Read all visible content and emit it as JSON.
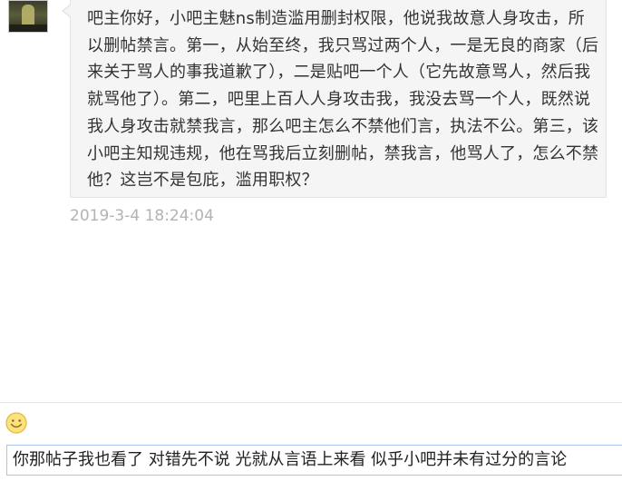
{
  "message": {
    "text": "吧主你好，小吧主魅ns制造滥用删封权限，他说我故意人身攻击，所以删帖禁言。第一，从始至终，我只骂过两个人，一是无良的商家（后来关于骂人的事我道歉了），二是贴吧一个人（它先故意骂人，然后我就骂他了）。第二，吧里上百人人身攻击我，我没去骂一个人，既然说我人身攻击就禁我言，那么吧主怎么不禁他们言，执法不公。第三，该小吧主知规违规，他在骂我后立刻删帖，禁我言，他骂人了，怎么不禁他？这岂不是包庇，滥用职权？",
    "timestamp": "2019-3-4 18:24:04"
  },
  "composer": {
    "emoji_icon": "smiley-face-icon",
    "input_value": "你那帖子我也看了 对错先不说 光就从言语上来看 似乎小吧并未有过分的言论"
  },
  "colors": {
    "bubble_bg": "#f5f5f5",
    "bubble_border": "#e2e2e2",
    "timestamp": "#b3b3b3",
    "input_border": "#a9c4e8",
    "emoji": "#f2c94c"
  }
}
